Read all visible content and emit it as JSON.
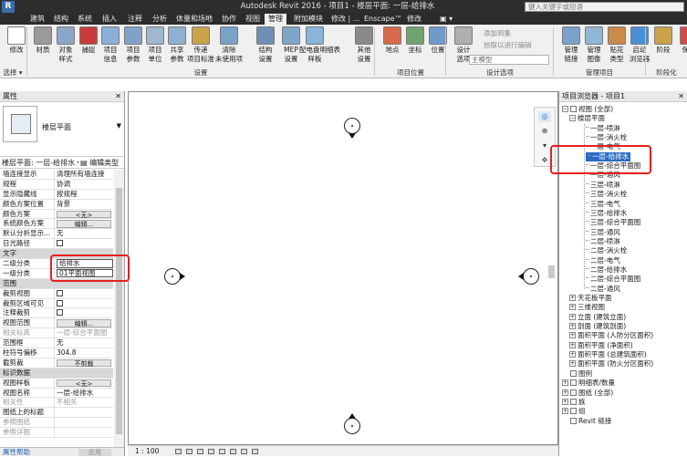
{
  "title_bar": {
    "app_icon": "R",
    "title": "Autodesk Revit 2016 -   项目1 - 楼层平面: 一层-给排水",
    "search_placeholder": "键入关键字或短语"
  },
  "menu_tabs": [
    "建筑",
    "结构",
    "系统",
    "插入",
    "注释",
    "分析",
    "体量和场地",
    "协作",
    "视图",
    "管理",
    "附加模块",
    "修改 | ...",
    "Enscape™",
    "修改",
    "▣ ▾"
  ],
  "active_tab": "管理",
  "ribbon": {
    "buttons": [
      {
        "label": "修改",
        "icon": "cursor-icon"
      },
      {
        "label": "材质",
        "icon": "material-sphere-icon"
      },
      {
        "label": "对象\n样式",
        "icon": "object-styles-icon"
      },
      {
        "label": "捕捉",
        "icon": "snap-magnet-icon"
      },
      {
        "label": "项目\n信息",
        "icon": "project-info-icon"
      },
      {
        "label": "项目\n参数",
        "icon": "project-params-icon"
      },
      {
        "label": "项目\n单位",
        "icon": "project-units-icon"
      },
      {
        "label": "共享\n参数",
        "icon": "shared-params-icon"
      },
      {
        "label": "传递\n项目标准",
        "icon": "transfer-standards-icon"
      },
      {
        "label": "清除\n未使用项",
        "icon": "purge-icon"
      },
      {
        "label": "结构\n设置",
        "icon": "structural-settings-icon"
      },
      {
        "label": "MEP\n设置",
        "icon": "mep-settings-icon"
      },
      {
        "label": "配电盘明细表\n样板",
        "icon": "panel-schedule-icon"
      },
      {
        "label": "其他\n设置",
        "icon": "wrench-icon"
      },
      {
        "label": "地点",
        "icon": "location-icon"
      },
      {
        "label": "坐标",
        "icon": "coordinates-icon"
      },
      {
        "label": "位置",
        "icon": "position-icon"
      },
      {
        "label": "设计\n选项",
        "icon": "design-options-icon"
      },
      {
        "label": "管理\n链接",
        "icon": "manage-links-icon"
      },
      {
        "label": "管理\n图像",
        "icon": "manage-images-icon"
      },
      {
        "label": "贴花\n类型",
        "icon": "decal-icon"
      },
      {
        "label": "启动\n浏览器",
        "icon": "browser-icon"
      },
      {
        "label": "阶段",
        "icon": "phases-icon"
      },
      {
        "label": "保存",
        "icon": "save-icon"
      }
    ],
    "small_buttons": [
      "添加到集",
      "拾取以进行编辑"
    ],
    "main_model_combo": "主模型",
    "groups": [
      "选择 ▾",
      "设置",
      "项目位置",
      "设计选项",
      "管理项目",
      "阶段化"
    ]
  },
  "properties": {
    "title": "属性",
    "type_name": "楼层平面",
    "instance_selector": "楼层平面: 一层-给排水",
    "edit_type": "编辑类型",
    "rows": [
      {
        "k": "墙连接显示",
        "v": "清理所有墙连接",
        "t": "text"
      },
      {
        "k": "规程",
        "v": "协调",
        "t": "text"
      },
      {
        "k": "显示隐藏线",
        "v": "按规程",
        "t": "text"
      },
      {
        "k": "颜色方案位置",
        "v": "背景",
        "t": "text"
      },
      {
        "k": "颜色方案",
        "v": "<无>",
        "t": "button"
      },
      {
        "k": "系统颜色方案",
        "v": "编辑...",
        "t": "button"
      },
      {
        "k": "默认分析显示...",
        "v": "无",
        "t": "text"
      },
      {
        "k": "日光路径",
        "v": "",
        "t": "check"
      },
      {
        "k": "文字",
        "v": "",
        "t": "section"
      },
      {
        "k": "二级分类",
        "v": "给排水",
        "t": "input"
      },
      {
        "k": "一级分类",
        "v": "01平面视图",
        "t": "input"
      },
      {
        "k": "范围",
        "v": "",
        "t": "section"
      },
      {
        "k": "裁剪视图",
        "v": "",
        "t": "check"
      },
      {
        "k": "裁剪区域可见",
        "v": "",
        "t": "check"
      },
      {
        "k": "注释裁剪",
        "v": "",
        "t": "check"
      },
      {
        "k": "视图范围",
        "v": "编辑...",
        "t": "button"
      },
      {
        "k": "相关标高",
        "v": "一层-综合平面图",
        "t": "grey"
      },
      {
        "k": "范围框",
        "v": "无",
        "t": "text"
      },
      {
        "k": "柱符号偏移",
        "v": "304.8",
        "t": "text"
      },
      {
        "k": "截剪裁",
        "v": "不剪裁",
        "t": "button"
      },
      {
        "k": "标识数据",
        "v": "",
        "t": "section"
      },
      {
        "k": "视图样板",
        "v": "<无>",
        "t": "button"
      },
      {
        "k": "视图名称",
        "v": "一层-给排水",
        "t": "text"
      },
      {
        "k": "相关性",
        "v": "不相关",
        "t": "grey"
      },
      {
        "k": "图纸上的标题",
        "v": "",
        "t": "text"
      },
      {
        "k": "参照图纸",
        "v": "",
        "t": "grey"
      },
      {
        "k": "参照详图",
        "v": "",
        "t": "grey"
      }
    ],
    "help_link": "属性帮助",
    "apply_button": "应用"
  },
  "status_bar": {
    "scale": "1 : 100"
  },
  "browser": {
    "title": "项目浏览器 - 项目1",
    "nodes": [
      {
        "label": "视图 (全部)",
        "level": 0,
        "exp": "−",
        "icon": true
      },
      {
        "label": "楼层平面",
        "level": 1,
        "exp": "−"
      },
      {
        "label": "一层-喷淋",
        "level": 2
      },
      {
        "label": "一层-消火栓",
        "level": 2
      },
      {
        "label": "一层-电气",
        "level": 2
      },
      {
        "label": "一层-给排水",
        "level": 2,
        "selected": true
      },
      {
        "label": "一层-综合平面图",
        "level": 2
      },
      {
        "label": "一层-通风",
        "level": 2
      },
      {
        "label": "三层-喷淋",
        "level": 2
      },
      {
        "label": "三层-消火栓",
        "level": 2
      },
      {
        "label": "三层-电气",
        "level": 2
      },
      {
        "label": "三层-给排水",
        "level": 2
      },
      {
        "label": "三层-综合平面图",
        "level": 2
      },
      {
        "label": "三层-通风",
        "level": 2
      },
      {
        "label": "二层-喷淋",
        "level": 2
      },
      {
        "label": "二层-消火栓",
        "level": 2
      },
      {
        "label": "二层-电气",
        "level": 2
      },
      {
        "label": "二层-给排水",
        "level": 2
      },
      {
        "label": "二层-综合平面图",
        "level": 2
      },
      {
        "label": "二层-通风",
        "level": 2
      },
      {
        "label": "天花板平面",
        "level": 1,
        "exp": "+"
      },
      {
        "label": "三维视图",
        "level": 1,
        "exp": "+"
      },
      {
        "label": "立面 (建筑立面)",
        "level": 1,
        "exp": "+"
      },
      {
        "label": "剖面 (建筑剖面)",
        "level": 1,
        "exp": "+"
      },
      {
        "label": "面积平面 (人防分区面积)",
        "level": 1,
        "exp": "+"
      },
      {
        "label": "面积平面 (净面积)",
        "level": 1,
        "exp": "+"
      },
      {
        "label": "面积平面 (总建筑面积)",
        "level": 1,
        "exp": "+"
      },
      {
        "label": "面积平面 (防火分区面积)",
        "level": 1,
        "exp": "+"
      },
      {
        "label": "图例",
        "level": 0,
        "icon": true
      },
      {
        "label": "明细表/数量",
        "level": 0,
        "exp": "+",
        "icon": true
      },
      {
        "label": "图纸 (全部)",
        "level": 0,
        "exp": "+",
        "icon": true
      },
      {
        "label": "族",
        "level": 0,
        "exp": "+",
        "icon": true
      },
      {
        "label": "组",
        "level": 0,
        "exp": "+",
        "icon": true
      },
      {
        "label": "Revit 链接",
        "level": 0,
        "icon": true
      }
    ]
  },
  "colors": {
    "accent": "#2a6cc4",
    "highlight": "#e51f1f",
    "titlebar": "#2d2d2d"
  }
}
